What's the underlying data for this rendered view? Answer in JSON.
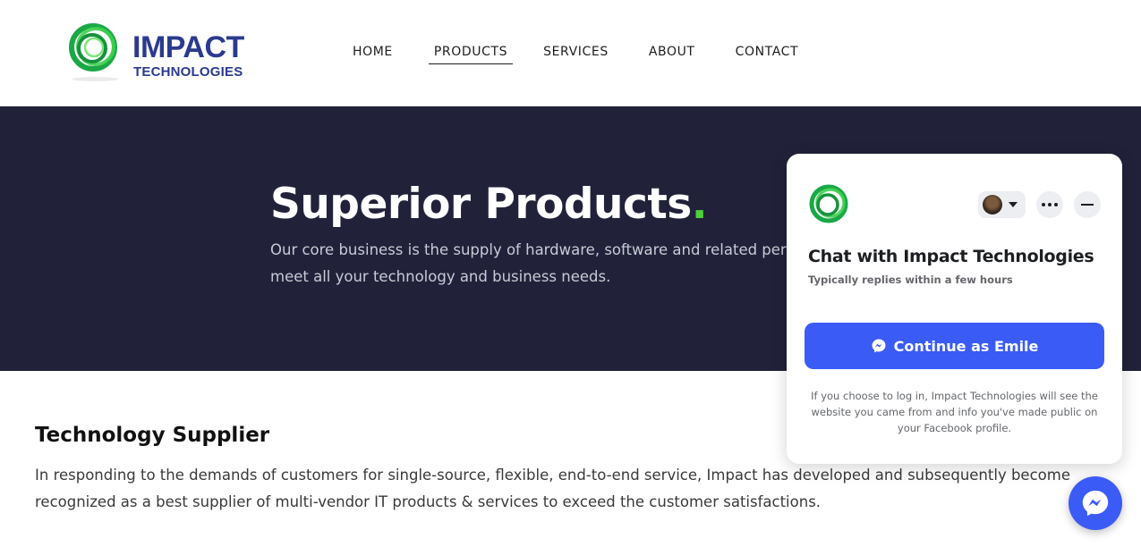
{
  "brand": {
    "name": "IMPACT",
    "tagline": "TECHNOLOGIES",
    "primary_color": "#2b3a8f",
    "mark_color": "#22b14c"
  },
  "nav": {
    "items": [
      {
        "label": "HOME",
        "active": false
      },
      {
        "label": "PRODUCTS",
        "active": true
      },
      {
        "label": "SERVICES",
        "active": false
      },
      {
        "label": "ABOUT",
        "active": false
      },
      {
        "label": "CONTACT",
        "active": false
      }
    ]
  },
  "hero": {
    "title": "Superior Products",
    "title_dot": ".",
    "text": "Our core business is the supply of hardware, software and related peri",
    "text_line2": "meet all your technology and business needs.",
    "background": "#21223a",
    "accent": "#4cd137"
  },
  "section": {
    "title": "Technology Supplier",
    "text": "In responding to the demands of customers for single-source, flexible, end-to-end service, Impact has developed and subsequently become recognized as a best supplier of multi-vendor IT products & services to exceed the customer satisfactions."
  },
  "chat": {
    "title": "Chat with Impact Technologies",
    "subtitle": "Typically replies within a few hours",
    "continue_label": "Continue as Emile",
    "note": "If you choose to log in, Impact Technologies will see the website you came from and info you've made public on your Facebook profile.",
    "button_color": "#3b5bf6",
    "icons": {
      "account": "user-avatar-icon",
      "more": "more-options-icon",
      "minimize": "minimize-icon",
      "messenger": "messenger-icon"
    }
  }
}
